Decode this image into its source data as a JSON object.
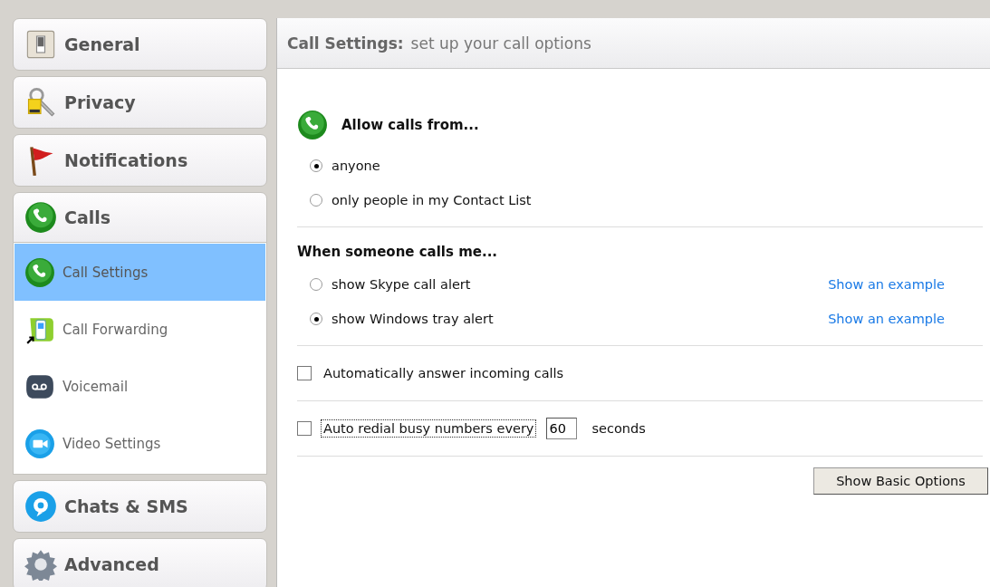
{
  "sidebar": {
    "sections": [
      {
        "label": "General",
        "kind": "general",
        "expanded": false
      },
      {
        "label": "Privacy",
        "kind": "privacy",
        "expanded": false
      },
      {
        "label": "Notifications",
        "kind": "notifications",
        "expanded": false
      },
      {
        "label": "Calls",
        "kind": "calls",
        "expanded": true,
        "children": [
          {
            "label": "Call Settings",
            "kind": "calls",
            "selected": true
          },
          {
            "label": "Call Forwarding",
            "kind": "forwarding",
            "selected": false
          },
          {
            "label": "Voicemail",
            "kind": "voicemail",
            "selected": false
          },
          {
            "label": "Video Settings",
            "kind": "video",
            "selected": false
          }
        ]
      },
      {
        "label": "Chats & SMS",
        "kind": "chats",
        "expanded": false
      },
      {
        "label": "Advanced",
        "kind": "advanced",
        "expanded": false
      }
    ]
  },
  "header": {
    "title": "Call Settings:",
    "subtitle": "set up your call options"
  },
  "groups": [
    {
      "kind": "icon_radios",
      "heading": "Allow calls from...",
      "options": [
        {
          "label": "anyone",
          "selected": true
        },
        {
          "label": "only people in my Contact List",
          "selected": false
        }
      ]
    },
    {
      "kind": "radios",
      "heading": "When someone calls me...",
      "options": [
        {
          "label": "show Skype call alert",
          "selected": false,
          "link": "Show an example"
        },
        {
          "label": "show Windows tray alert",
          "selected": true,
          "link": "Show an example"
        }
      ]
    },
    {
      "kind": "checkbox",
      "label": "Automatically answer incoming calls",
      "checked": false,
      "focused": false
    },
    {
      "kind": "checkbox_input",
      "label": "Auto redial busy numbers every",
      "checked": false,
      "focused": true,
      "value": "60",
      "suffix": "seconds"
    }
  ],
  "button": "Show Basic Options"
}
